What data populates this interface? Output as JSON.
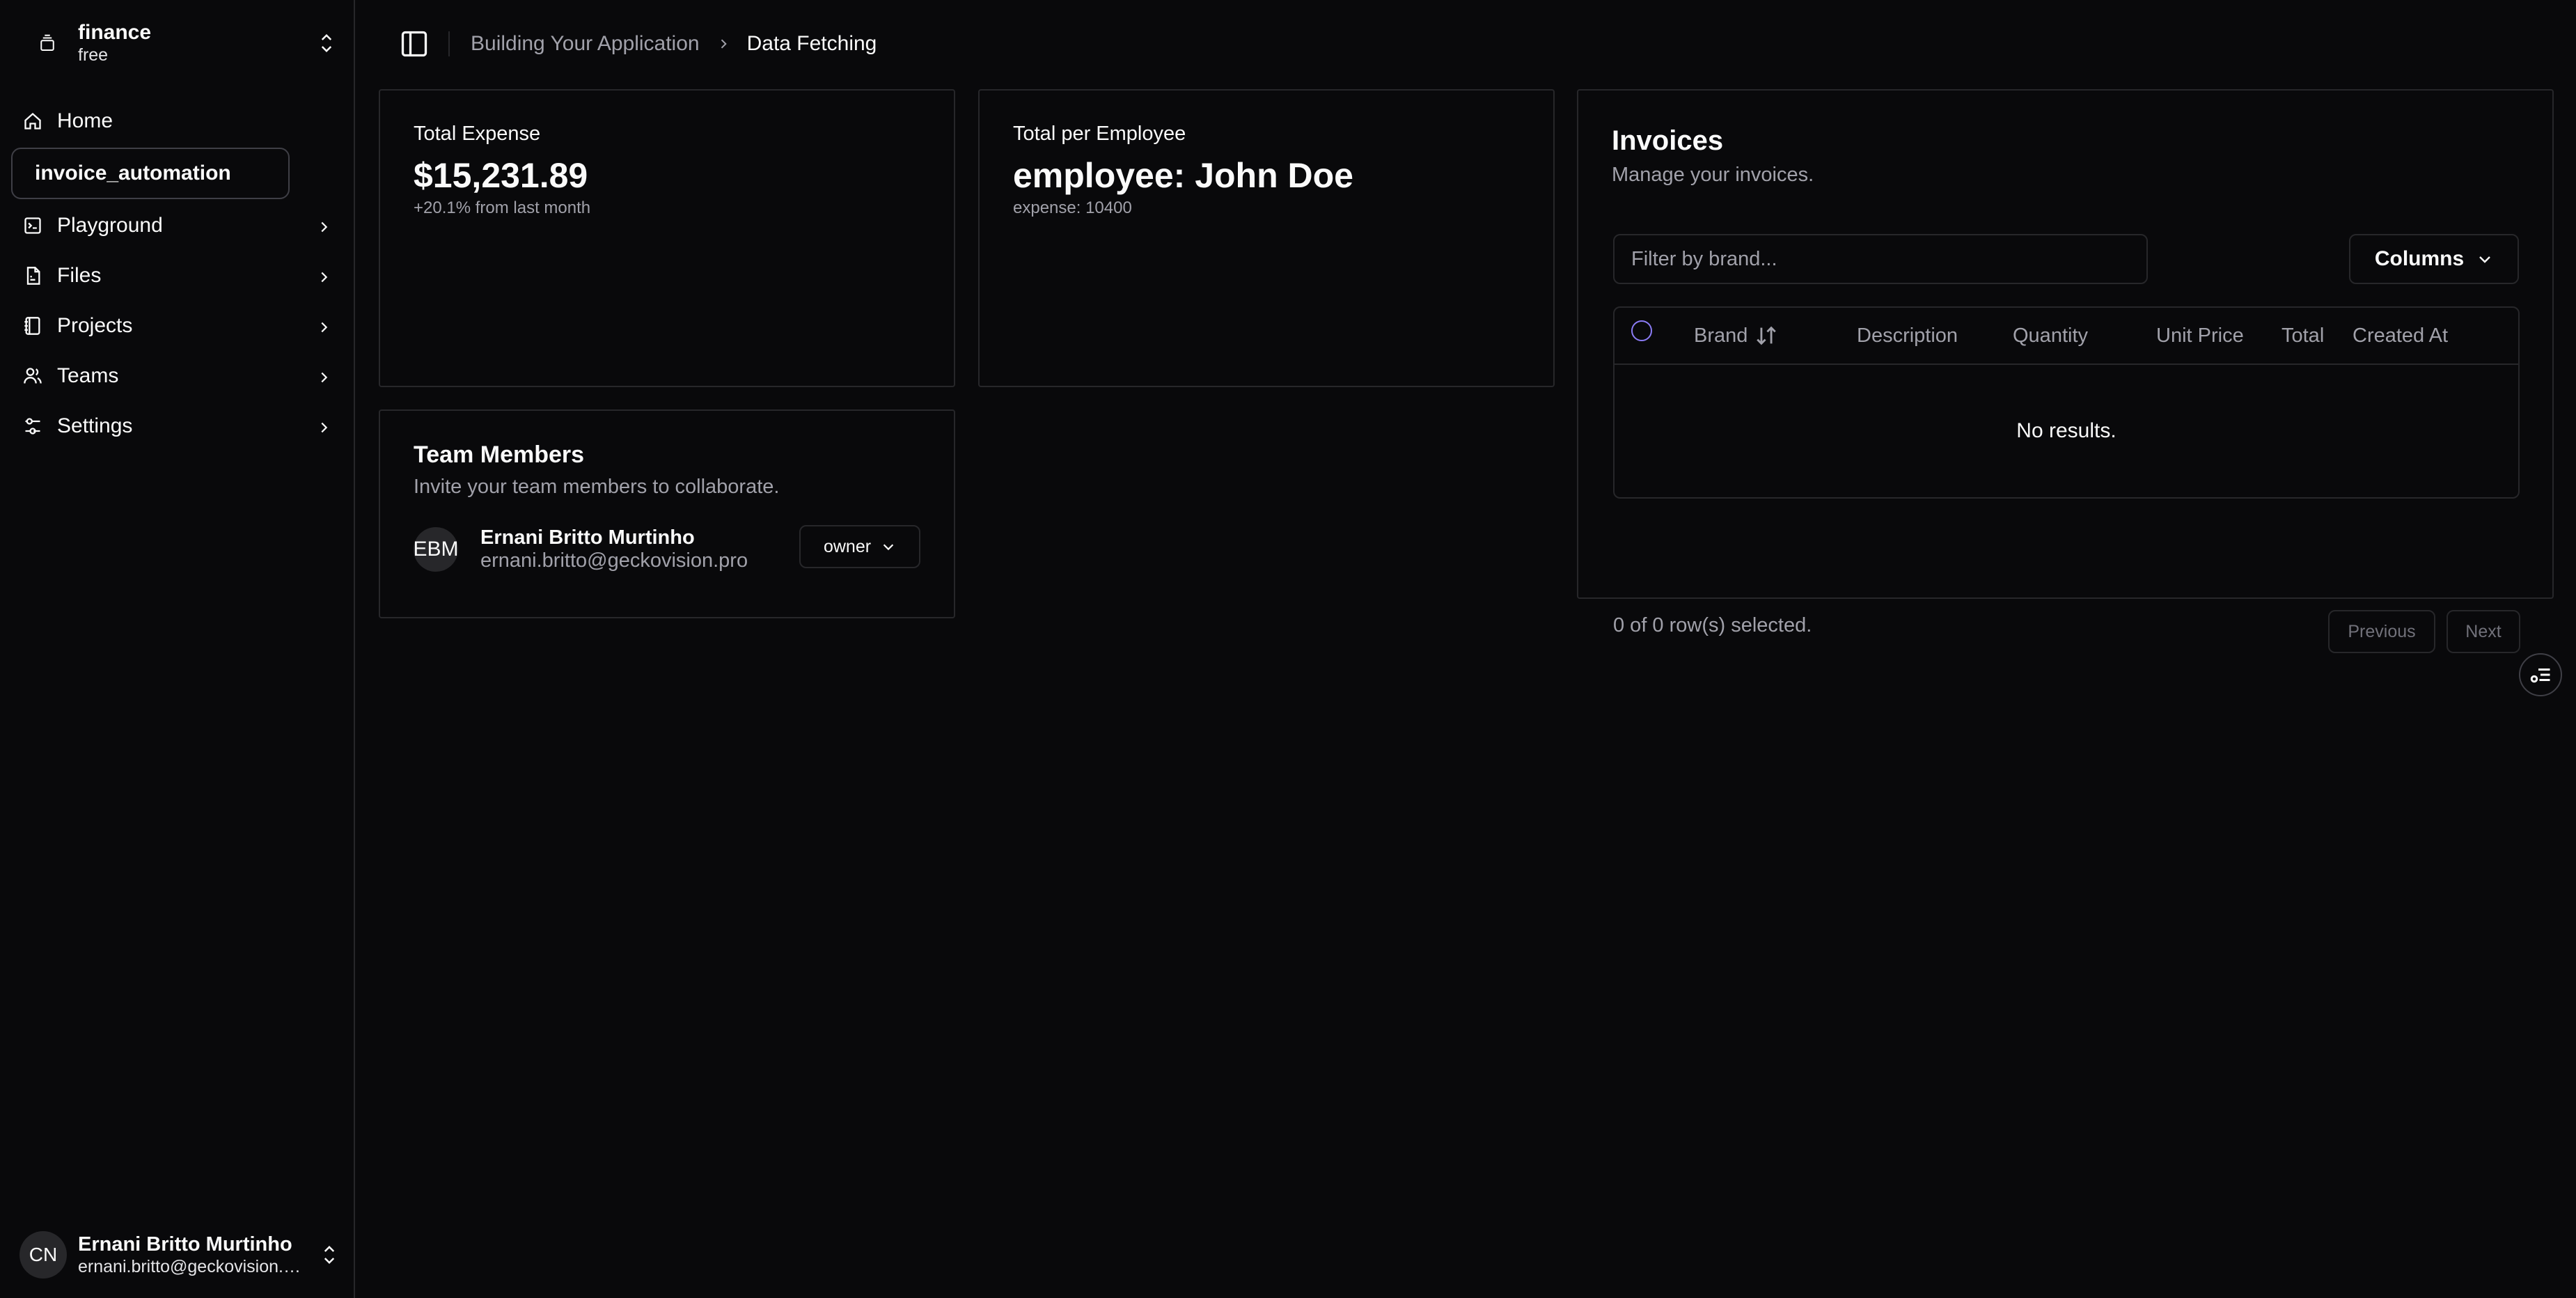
{
  "team": {
    "name": "finance",
    "plan": "free"
  },
  "nav": {
    "home": "Home",
    "active_item": "invoice_automation",
    "playground": "Playground",
    "files": "Files",
    "projects": "Projects",
    "teams": "Teams",
    "settings": "Settings"
  },
  "user": {
    "initials": "CN",
    "name": "Ernani Britto Murtinho",
    "email": "ernani.britto@geckovision.pro"
  },
  "breadcrumb": {
    "parent": "Building Your Application",
    "current": "Data Fetching"
  },
  "total_expense": {
    "label": "Total Expense",
    "value": "$15,231.89",
    "sub": "+20.1% from last month"
  },
  "per_employee": {
    "label": "Total per Employee",
    "value": "employee: John Doe",
    "sub": "expense: 10400"
  },
  "team_members": {
    "title": "Team Members",
    "description": "Invite your team members to collaborate.",
    "members": [
      {
        "initials": "EBM",
        "name": "Ernani Britto Murtinho",
        "email": "ernani.britto@geckovision.pro",
        "role": "owner"
      }
    ]
  },
  "invoices": {
    "title": "Invoices",
    "description": "Manage your invoices.",
    "filter_placeholder": "Filter by brand...",
    "columns_label": "Columns",
    "headers": [
      "Brand",
      "Description",
      "Quantity",
      "Unit Price",
      "Total",
      "Created At"
    ],
    "empty_text": "No results.",
    "selected_text": "0 of 0 row(s) selected.",
    "previous_label": "Previous",
    "next_label": "Next"
  },
  "colors": {
    "background": "#09090b",
    "border": "#27272a",
    "muted": "#a1a1aa",
    "checkbox_accent": "#8b7cf6"
  }
}
